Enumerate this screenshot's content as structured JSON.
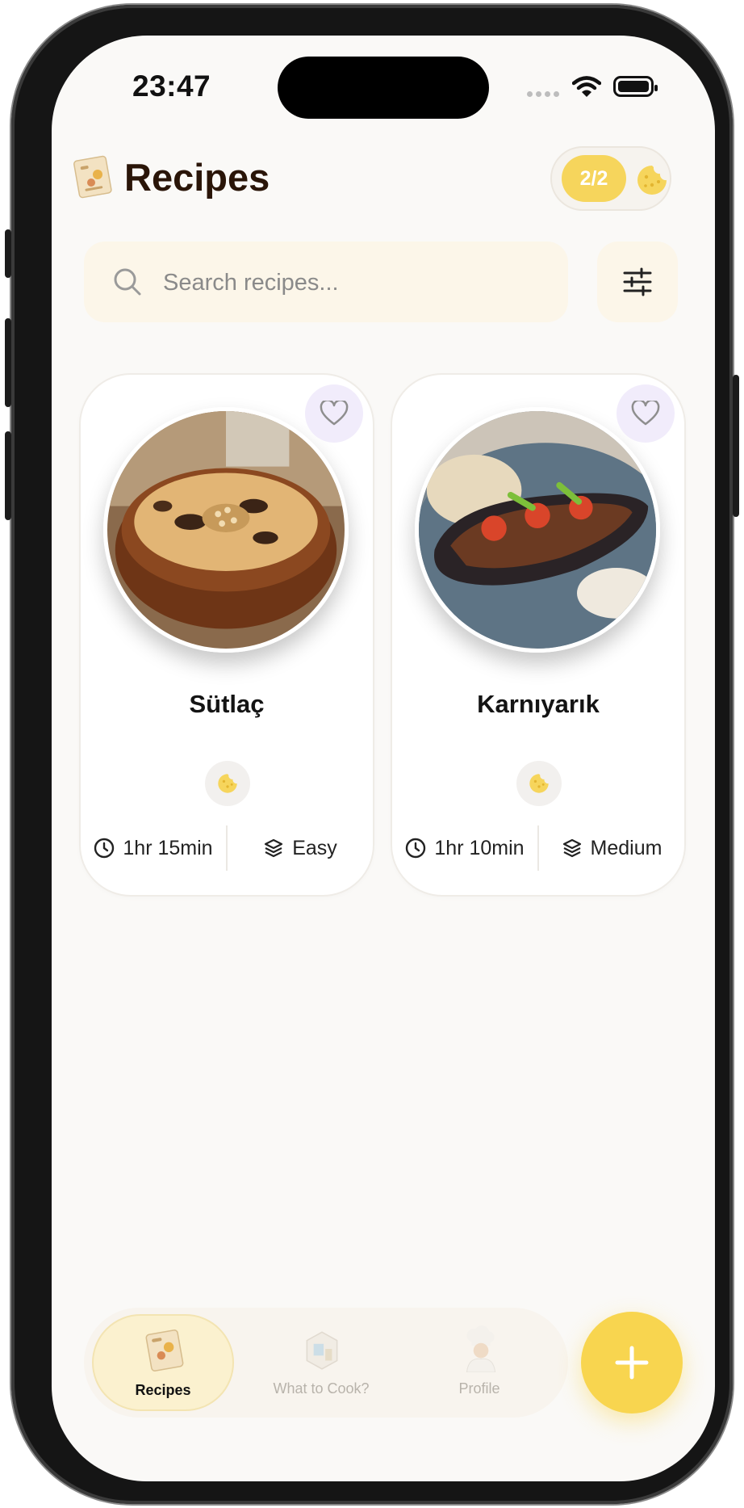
{
  "status_bar": {
    "time": "23:47"
  },
  "header": {
    "title": "Recipes",
    "credits": "2/2"
  },
  "search": {
    "placeholder": "Search recipes..."
  },
  "recipes": [
    {
      "name": "Sütlaç",
      "duration": "1hr 15min",
      "difficulty": "Easy"
    },
    {
      "name": "Karnıyarık",
      "duration": "1hr 10min",
      "difficulty": "Medium"
    }
  ],
  "tabs": [
    {
      "label": "Recipes",
      "active": true
    },
    {
      "label": "What to Cook?",
      "active": false
    },
    {
      "label": "Profile",
      "active": false
    }
  ],
  "colors": {
    "accent": "#f8d54f",
    "background": "#faf9f7",
    "title": "#2a1508"
  }
}
